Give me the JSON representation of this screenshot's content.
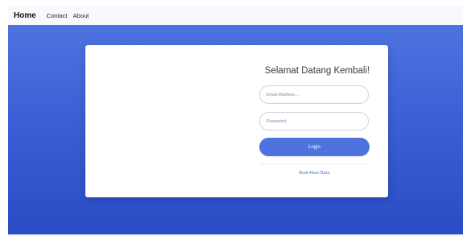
{
  "navbar": {
    "brand": "Home",
    "links": [
      "Contact",
      "About"
    ]
  },
  "login": {
    "title": "Selamat Datang Kembali!",
    "email_placeholder": "Email Address...",
    "password_placeholder": "Password",
    "button_label": "Login",
    "register_link": "Buat Akun Baru"
  },
  "colors": {
    "primary": "#4e73df",
    "hero_gradient_end": "#2a4bc4",
    "navbar_bg": "#f8f9fc",
    "card_bg": "#ffffff",
    "title_text": "#3a3b45"
  }
}
